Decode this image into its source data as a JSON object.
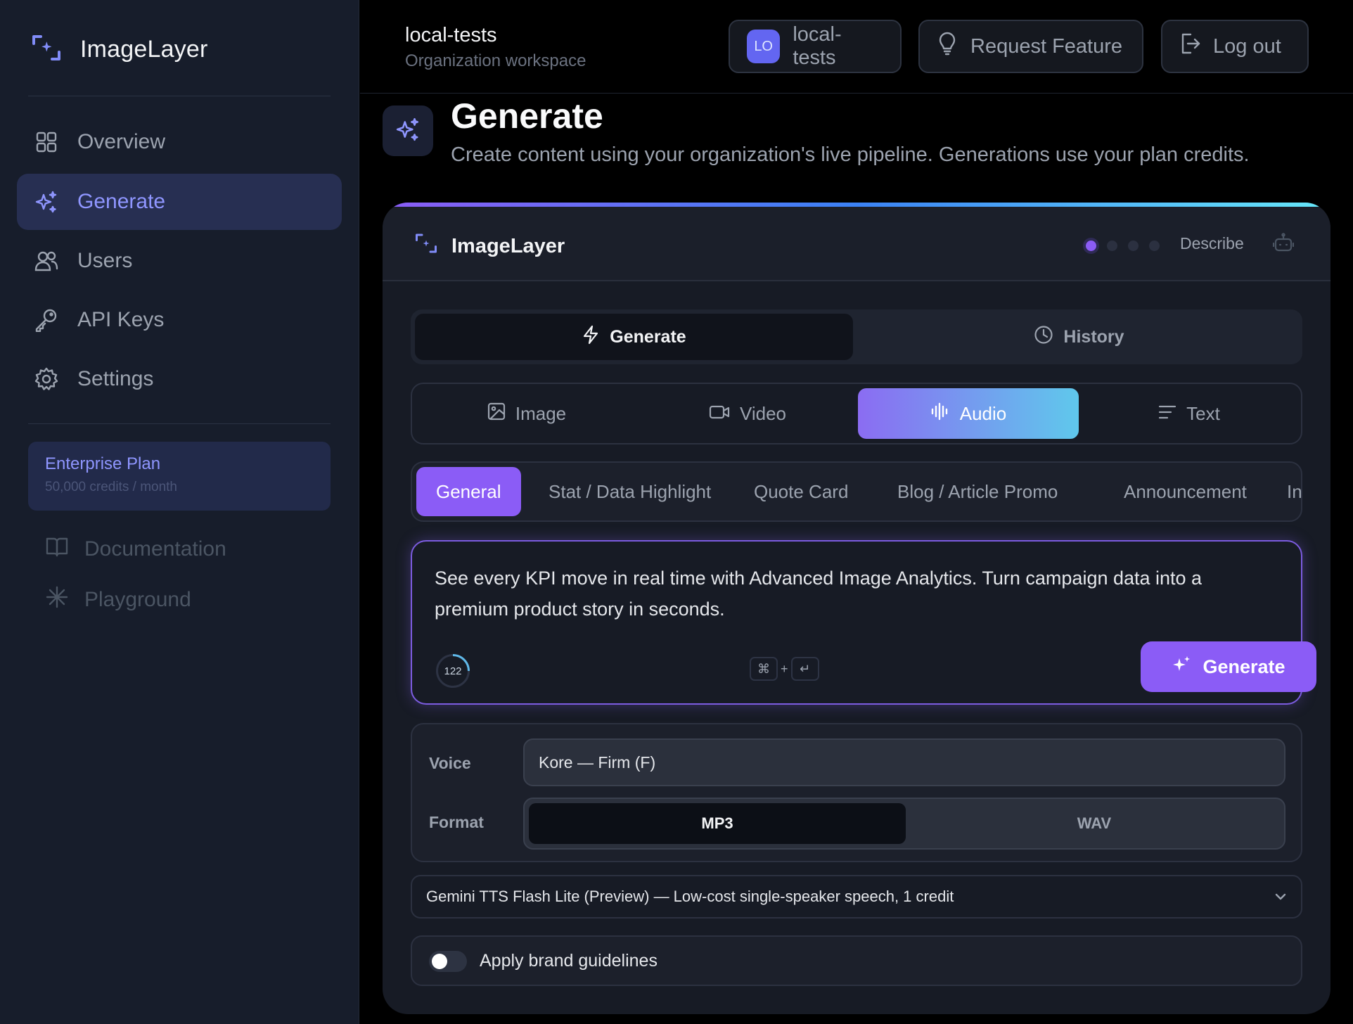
{
  "sidebar": {
    "brand": "ImageLayer",
    "nav": [
      {
        "label": "Overview",
        "icon": "grid-icon"
      },
      {
        "label": "Generate",
        "icon": "sparkles-icon",
        "active": true
      },
      {
        "label": "Users",
        "icon": "users-icon"
      },
      {
        "label": "API Keys",
        "icon": "key-icon"
      },
      {
        "label": "Settings",
        "icon": "gear-icon"
      }
    ],
    "plan": {
      "name": "Enterprise Plan",
      "credits": "50,000 credits / month"
    },
    "links": [
      {
        "label": "Documentation",
        "icon": "book-icon"
      },
      {
        "label": "Playground",
        "icon": "asterisk-icon"
      }
    ]
  },
  "topbar": {
    "org_name": "local-tests",
    "org_sub": "Organization workspace",
    "avatar_initials": "LO",
    "workspace_label": "local-tests",
    "request_feature": "Request Feature",
    "logout": "Log out"
  },
  "page": {
    "title": "Generate",
    "subtitle": "Create content using your organization's live pipeline. Generations use your plan credits."
  },
  "card": {
    "brand": "ImageLayer",
    "steps_total": 4,
    "step_active": 1,
    "describe_label": "Describe",
    "mode_tabs": [
      "Generate",
      "History"
    ],
    "media_tabs": [
      "Image",
      "Video",
      "Audio",
      "Text"
    ],
    "active_media": "Audio",
    "templates": [
      "General",
      "Stat / Data Highlight",
      "Quote Card",
      "Blog / Article Promo",
      "Announcement",
      "In"
    ],
    "active_template": "General",
    "prompt": "See every KPI move in real time with Advanced Image Analytics. Turn campaign data into a premium product story in seconds.",
    "char_count": "122",
    "kbd_cmd": "⌘",
    "kbd_plus": "+",
    "kbd_enter": "↵",
    "generate_button": "Generate",
    "voice_label": "Voice",
    "voice_value": "Kore — Firm (F)",
    "format_label": "Format",
    "formats": [
      "MP3",
      "WAV"
    ],
    "active_format": "MP3",
    "model": "Gemini TTS Flash Lite (Preview) — Low-cost single-speaker speech, 1 credit",
    "brand_toggle_label": "Apply brand guidelines",
    "brand_toggle_on": false
  },
  "colors": {
    "accent": "#8b5cf6",
    "sidebar_bg": "#171d2b",
    "nav_active": "#8f96ff",
    "audio_gradient": [
      "#8b6cf2",
      "#5fc8ec"
    ]
  }
}
